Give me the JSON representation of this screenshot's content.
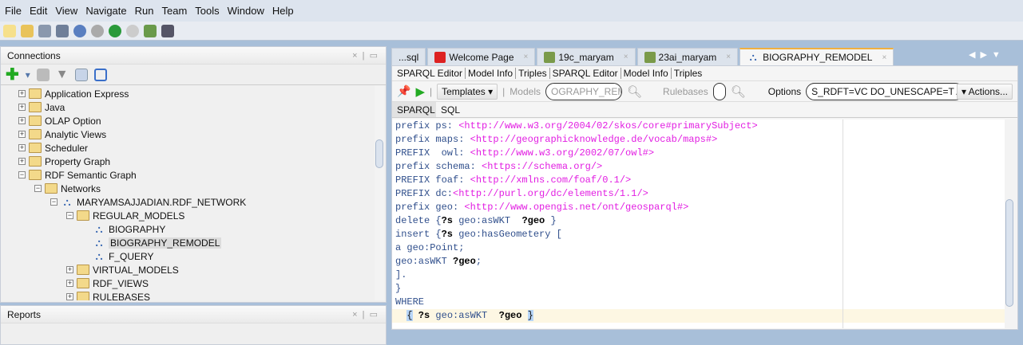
{
  "menu": [
    "File",
    "Edit",
    "View",
    "Navigate",
    "Run",
    "Team",
    "Tools",
    "Window",
    "Help"
  ],
  "connections": {
    "title": "Connections",
    "tree": [
      {
        "label": "Application Express",
        "level": 0,
        "exp": "+",
        "icon": "folder"
      },
      {
        "label": "Java",
        "level": 0,
        "exp": "+",
        "icon": "folder"
      },
      {
        "label": "OLAP Option",
        "level": 0,
        "exp": "+",
        "icon": "folder"
      },
      {
        "label": "Analytic Views",
        "level": 0,
        "exp": "+",
        "icon": "folder"
      },
      {
        "label": "Scheduler",
        "level": 0,
        "exp": "+",
        "icon": "folder"
      },
      {
        "label": "Property Graph",
        "level": 0,
        "exp": "+",
        "icon": "folder"
      },
      {
        "label": "RDF Semantic Graph",
        "level": 0,
        "exp": "-",
        "icon": "folder"
      },
      {
        "label": "Networks",
        "level": 1,
        "exp": "-",
        "icon": "folder"
      },
      {
        "label": "MARYAMSAJJADIAN.RDF_NETWORK",
        "level": 2,
        "exp": "-",
        "icon": "graph"
      },
      {
        "label": "REGULAR_MODELS",
        "level": 3,
        "exp": "-",
        "icon": "folder"
      },
      {
        "label": "BIOGRAPHY",
        "level": 4,
        "exp": "",
        "icon": "graph"
      },
      {
        "label": "BIOGRAPHY_REMODEL",
        "level": 4,
        "exp": "",
        "icon": "graph",
        "selected": true
      },
      {
        "label": "F_QUERY",
        "level": 4,
        "exp": "",
        "icon": "graph"
      },
      {
        "label": "VIRTUAL_MODELS",
        "level": 3,
        "exp": "+",
        "icon": "folder"
      },
      {
        "label": "RDF_VIEWS",
        "level": 3,
        "exp": "+",
        "icon": "folder"
      },
      {
        "label": "RULEBASES",
        "level": 3,
        "exp": "+",
        "icon": "folder"
      }
    ]
  },
  "reports": {
    "title": "Reports"
  },
  "tabs": [
    {
      "label": "...sql"
    },
    {
      "label": "Welcome Page"
    },
    {
      "label": "19c_maryam"
    },
    {
      "label": "23ai_maryam"
    },
    {
      "label": "BIOGRAPHY_REMODEL",
      "active": true
    }
  ],
  "subtabs": [
    "SPARQL Editor",
    "Model Info",
    "Triples",
    "SPARQL Editor",
    "Model Info",
    "Triples"
  ],
  "etool": {
    "templates": "Templates",
    "models_label": "Models",
    "models_value": "OGRAPHY_REMO",
    "rulebases_label": "Rulebases",
    "rulebases_value": "",
    "options_label": "Options",
    "options_value": "S_RDFT=VC DO_UNESCAPE=T ALLOW",
    "actions": "Actions..."
  },
  "query_tabs": [
    "SPARQL",
    "SQL"
  ],
  "code": [
    [
      [
        "kw",
        "prefix ps: "
      ],
      [
        "uri",
        "<http://www.w3.org/2004/02/skos/core#primarySubject>"
      ]
    ],
    [
      [
        "kw",
        "prefix maps: "
      ],
      [
        "uri",
        "<http://geographicknowledge.de/vocab/maps#>"
      ]
    ],
    [
      [
        "kw",
        "PREFIX  owl: "
      ],
      [
        "uri",
        "<http://www.w3.org/2002/07/owl#>"
      ]
    ],
    [
      [
        "kw",
        "prefix schema: "
      ],
      [
        "uri",
        "<https://schema.org/>"
      ]
    ],
    [
      [
        "kw",
        "PREFIX foaf: "
      ],
      [
        "uri",
        "<http://xmlns.com/foaf/0.1/>"
      ]
    ],
    [
      [
        "kw",
        "PREFIX dc:"
      ],
      [
        "uri",
        "<http://purl.org/dc/elements/1.1/>"
      ]
    ],
    [
      [
        "kw",
        "prefix geo: "
      ],
      [
        "uri",
        "<http://www.opengis.net/ont/geosparql#>"
      ]
    ],
    [
      [
        "kw",
        "delete {"
      ],
      [
        "var",
        "?s"
      ],
      [
        "kw",
        " geo:asWKT  "
      ],
      [
        "var",
        "?geo"
      ],
      [
        "kw",
        " }"
      ]
    ],
    [
      [
        "kw",
        "insert {"
      ],
      [
        "var",
        "?s"
      ],
      [
        "kw",
        " geo:hasGeometery ["
      ]
    ],
    [
      [
        "kw",
        "a geo:Point;"
      ]
    ],
    [
      [
        "kw",
        "geo:asWKT "
      ],
      [
        "var",
        "?geo"
      ],
      [
        "kw",
        ";"
      ]
    ],
    [
      [
        "kw",
        "]."
      ]
    ],
    [
      [
        "kw",
        "}"
      ]
    ],
    [
      [
        "kw",
        "WHERE"
      ]
    ],
    [
      [
        "kw",
        "  "
      ],
      [
        "br",
        "{"
      ],
      [
        "var",
        " ?s"
      ],
      [
        "kw",
        " geo:asWKT  "
      ],
      [
        "var",
        "?geo "
      ],
      [
        "br",
        "}"
      ]
    ]
  ]
}
